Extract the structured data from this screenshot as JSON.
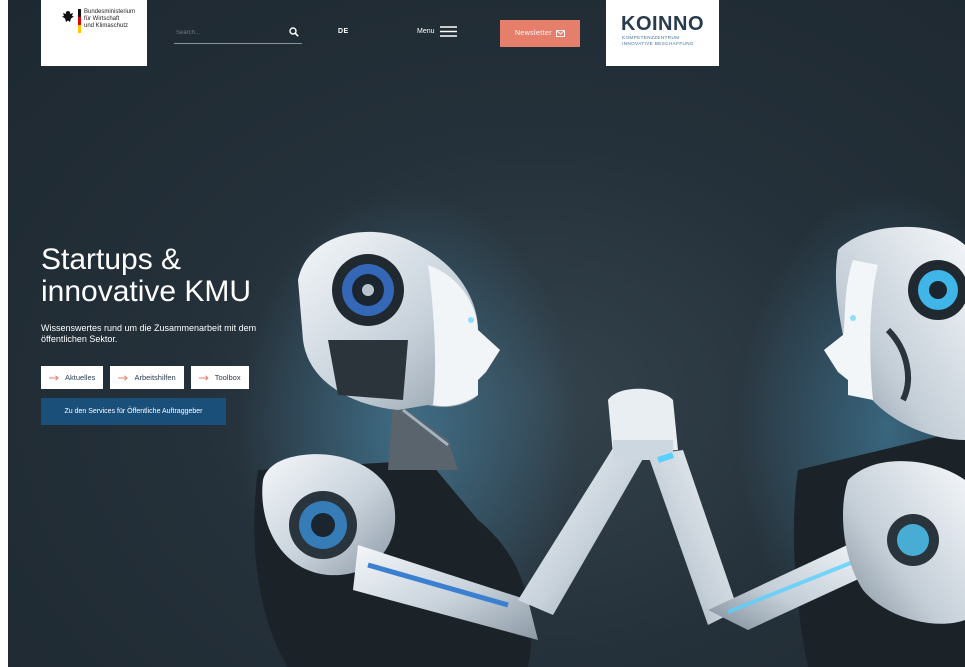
{
  "header": {
    "ministry_logo": {
      "lines": [
        "Bundesministerium",
        "für Wirtschaft",
        "und Klimaschutz"
      ]
    },
    "search": {
      "placeholder": "Search..."
    },
    "language": "DE",
    "menu_label": "Menu",
    "newsletter_label": "Newsletter",
    "partner_logo": {
      "wordmark": "KOINNO",
      "line1": "KOMPETENZZENTRUM",
      "line2": "INNOVATIVE BESCHAFFUNG"
    }
  },
  "hero": {
    "title_lines": [
      "Startups &",
      "innovative KMU"
    ],
    "subtitle_lines": [
      "Wissenswertes rund um die Zusammenarbeit mit dem",
      "öffentlichen Sektor."
    ],
    "link_buttons": [
      {
        "label": "Aktuelles"
      },
      {
        "label": "Arbeitshilfen"
      },
      {
        "label": "Toolbox"
      }
    ],
    "services_button": "Zu den Services für Öffentliche Auftraggeber"
  },
  "colors": {
    "background": "#25313a",
    "accent": "#e57f6c",
    "primary": "#1a4f7a",
    "text_dark": "#2a3f52"
  },
  "icons": [
    "search-icon",
    "menu-icon",
    "mail-icon",
    "arrow-right-icon",
    "eagle-icon"
  ]
}
